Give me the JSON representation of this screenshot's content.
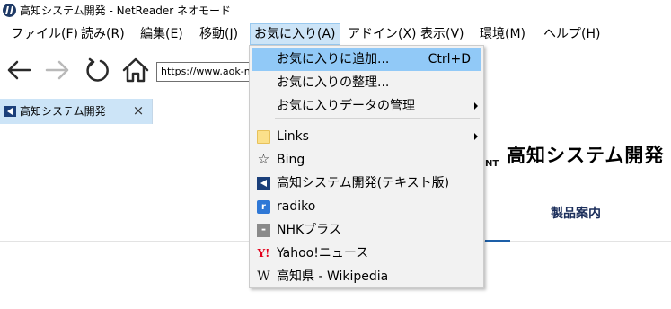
{
  "window": {
    "title": "高知システム開発 - NetReader ネオモード"
  },
  "menubar": {
    "items": [
      {
        "label": "ファイル(F)"
      },
      {
        "label": "読み(R)"
      },
      {
        "label": "編集(E)"
      },
      {
        "label": "移動(J)"
      },
      {
        "label": "お気に入り(A)"
      },
      {
        "label": "アドイン(X)"
      },
      {
        "label": "表示(V)"
      },
      {
        "label": "環境(M)"
      },
      {
        "label": "ヘルプ(H)"
      }
    ]
  },
  "navbar": {
    "back_icon": "back-arrow-icon",
    "forward_icon": "forward-arrow-icon",
    "refresh_icon": "refresh-icon",
    "home_icon": "home-icon",
    "url": "https://www.aok-n"
  },
  "tab": {
    "label": "高知システム開発",
    "close": "×"
  },
  "page": {
    "site_title": "高知システム開発",
    "site_sub": "NT",
    "product_link": "製品案内"
  },
  "favorites_menu": {
    "items": [
      {
        "label": "お気に入りに追加...",
        "shortcut": "Ctrl+D"
      },
      {
        "label": "お気に入りの整理..."
      },
      {
        "label": "お気に入りデータの管理"
      },
      {
        "label": "Links"
      },
      {
        "label": "Bing"
      },
      {
        "label": "高知システム開発(テキスト版)"
      },
      {
        "label": "radiko"
      },
      {
        "label": "NHKプラス"
      },
      {
        "label": "Yahoo!ニュース"
      },
      {
        "label": "高知県 - Wikipedia"
      }
    ]
  },
  "colors": {
    "menu_highlight": "#91c9f7",
    "menu_active": "#cce4f7",
    "tab_background": "#cce4f7",
    "brand": "#1b3f7a"
  }
}
